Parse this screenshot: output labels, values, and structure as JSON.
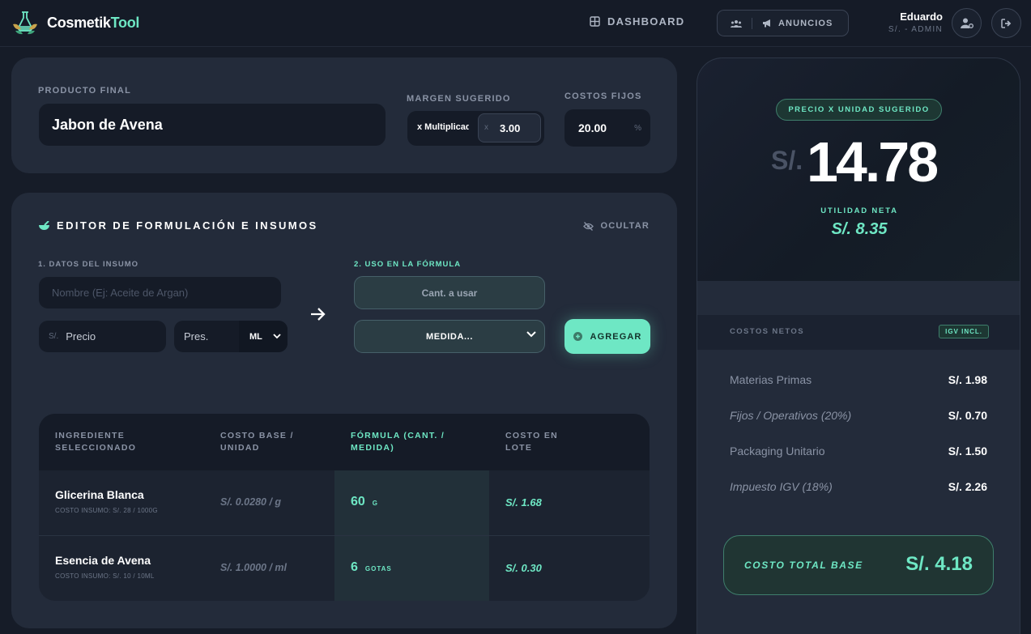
{
  "brand": {
    "name_part1": "Cosmetik",
    "name_part2": "Tool",
    "accent": "#6ee7c4"
  },
  "nav": {
    "dashboard_label": "DASHBOARD",
    "announcements_label": "ANUNCIOS",
    "team_icon": "users-icon",
    "announcements_icon": "megaphone-icon"
  },
  "user": {
    "name": "Eduardo",
    "role": "S/. - ADMIN"
  },
  "product": {
    "final_label": "PRODUCTO FINAL",
    "final_value": "Jabon de Avena",
    "margin_label": "MARGEN SUGERIDO",
    "margin_prefix": "x Multiplicador",
    "margin_x": "x",
    "margin_value": "3.00",
    "fixed_label": "COSTOS FIJOS",
    "fixed_value": "20.00",
    "fixed_unit": "%"
  },
  "editor": {
    "title": "EDITOR DE FORMULACIÓN E INSUMOS",
    "hide_label": "OCULTAR",
    "section1": "1. DATOS DEL INSUMO",
    "section2": "2. USO EN LA FÓRMULA",
    "name_placeholder": "Nombre (Ej: Aceite de Argan)",
    "price_currency": "S/.",
    "price_placeholder": "Precio",
    "pres_placeholder": "Pres.",
    "pres_unit": "ML",
    "qty_placeholder": "Cant. a usar",
    "measure_value": "MEDIDA...",
    "add_label": "AGREGAR"
  },
  "table": {
    "headers": [
      [
        "INGREDIENTE",
        "SELECCIONADO"
      ],
      [
        "COSTO BASE /",
        "UNIDAD"
      ],
      [
        "FÓRMULA (CANT. /",
        "MEDIDA)"
      ],
      [
        "COSTO EN",
        "LOTE"
      ]
    ],
    "rows": [
      {
        "name": "Glicerina Blanca",
        "sub": "COSTO INSUMO: S/. 28 / 1000G",
        "base": "S/. 0.0280 / g",
        "qty": "60",
        "unit": "G",
        "lot": "S/. 1.68"
      },
      {
        "name": "Esencia de Avena",
        "sub": "COSTO INSUMO: S/. 10 / 10ML",
        "base": "S/. 1.0000 / ml",
        "qty": "6",
        "unit": "GOTAS",
        "lot": "S/. 0.30"
      }
    ]
  },
  "summary": {
    "badge": "PRECIO X UNIDAD SUGERIDO",
    "currency": "S/.",
    "price": "14.78",
    "util_label": "UTILIDAD NETA",
    "util_value": "S/. 8.35",
    "costs_label": "COSTOS NETOS",
    "igv_badge": "IGV INCL.",
    "costs": [
      {
        "label": "Materias Primas",
        "value": "S/. 1.98"
      },
      {
        "label": "Fijos / Operativos (20%)",
        "value": "S/. 0.70"
      },
      {
        "label": "Packaging Unitario",
        "value": "S/. 1.50"
      },
      {
        "label": "Impuesto IGV (18%)",
        "value": "S/. 2.26"
      }
    ],
    "total_label": "COSTO TOTAL BASE",
    "total_value": "S/. 4.18"
  }
}
